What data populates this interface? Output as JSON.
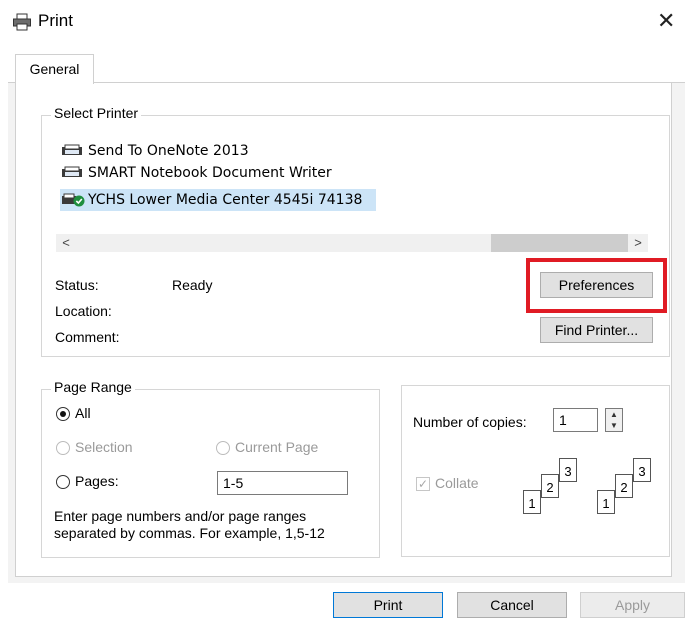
{
  "window": {
    "title": "Print",
    "close": "✕"
  },
  "tabs": [
    {
      "label": "General"
    }
  ],
  "select_printer": {
    "legend": "Select Printer",
    "printers": [
      {
        "name": "Send To OneNote 2013"
      },
      {
        "name": "SMART Notebook Document Writer"
      },
      {
        "name": "YCHS Lower Media Center 4545i 74138",
        "selected": true
      }
    ],
    "scroll_left": "<",
    "scroll_right": ">",
    "status_label": "Status:",
    "status_value": "Ready",
    "location_label": "Location:",
    "location_value": "",
    "comment_label": "Comment:",
    "comment_value": "",
    "preferences_button": "Preferences",
    "find_printer_button": "Find Printer..."
  },
  "page_range": {
    "legend": "Page Range",
    "all_label": "All",
    "selection_label": "Selection",
    "current_page_label": "Current Page",
    "pages_label": "Pages:",
    "pages_value": "1-5",
    "hint": "Enter page numbers and/or page ranges separated by commas.  For example, 1,5-12"
  },
  "copies": {
    "number_label": "Number of copies:",
    "number_value": "1",
    "collate_label": "Collate",
    "collate_checked": true,
    "page_numbers": [
      "1",
      "2",
      "3"
    ]
  },
  "buttons": {
    "print": "Print",
    "cancel": "Cancel",
    "apply": "Apply"
  },
  "colors": {
    "highlight": "#e01b24",
    "selection": "#cce4f7"
  }
}
